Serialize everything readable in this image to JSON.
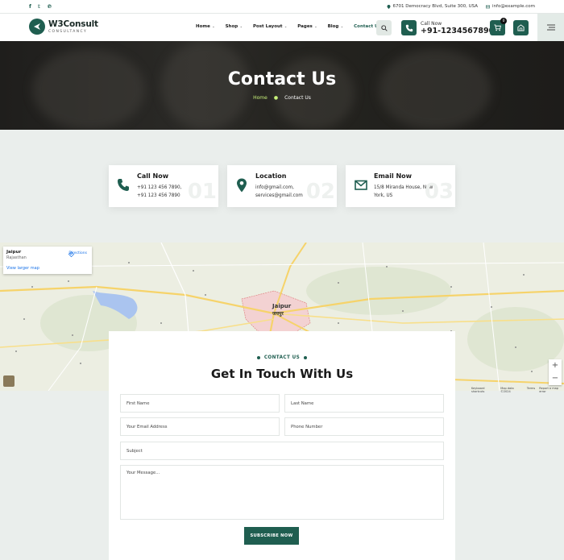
{
  "topbar": {
    "address": "6701 Democracy Blvd, Suite 300, USA",
    "email": "info@example.com"
  },
  "header": {
    "logo_name": "W3Consult",
    "logo_sub": "CONSULTANCY",
    "nav": [
      "Home",
      "Shop",
      "Post Layout",
      "Pages",
      "Blog",
      "Contact Us"
    ],
    "call_label": "Call Now",
    "call_number": "+91-1234567890",
    "cart_count": "0"
  },
  "hero": {
    "title": "Contact Us",
    "crumb_home": "Home",
    "crumb_current": "Contact Us"
  },
  "cards": [
    {
      "title": "Call Now",
      "lines": [
        "+91 123 456 7890,",
        "+91 123 456 7890"
      ],
      "num": "01",
      "icon": "phone-icon"
    },
    {
      "title": "Location",
      "lines": [
        "info@gmail.com,",
        "services@gmail.com"
      ],
      "num": "02",
      "icon": "map-pin-icon"
    },
    {
      "title": "Email Now",
      "lines": [
        "15/8 Miranda House, New",
        "York, US"
      ],
      "num": "03",
      "icon": "envelope-icon"
    }
  ],
  "map": {
    "place": "Jaipur",
    "region": "Rajasthan",
    "directions": "Directions",
    "larger_map": "View larger map",
    "city_label": "Jaipur",
    "city_label_local": "जयपुर",
    "footer": [
      "Keyboard shortcuts",
      "Map data ©2024",
      "Terms",
      "Report a map error"
    ]
  },
  "form": {
    "kicker": "CONTACT US",
    "title": "Get In Touch With Us",
    "first_name": "First Name",
    "last_name": "Last Name",
    "email": "Your Email Address",
    "phone": "Phone Number",
    "subject": "Subject",
    "message": "Your Message...",
    "submit": "SUBSCRIBE NOW"
  },
  "colors": {
    "brand": "#1f5e50",
    "accent": "#c8f27a",
    "background": "#eaeeec"
  }
}
